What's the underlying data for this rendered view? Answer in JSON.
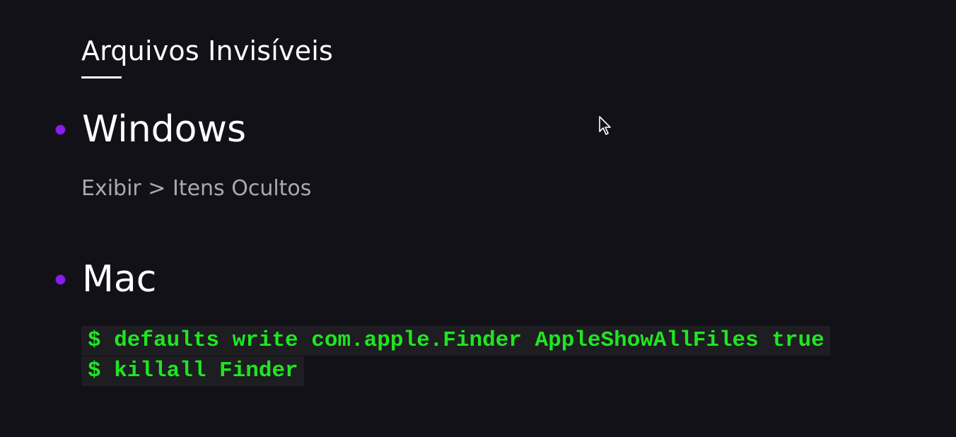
{
  "slide": {
    "title": "Arquivos Invisíveis",
    "sections": [
      {
        "heading": "Windows",
        "description": "Exibir > Itens Ocultos"
      },
      {
        "heading": "Mac",
        "code_lines": [
          "$ defaults write com.apple.Finder AppleShowAllFiles true",
          "$ killall Finder"
        ]
      }
    ]
  },
  "colors": {
    "background": "#121117",
    "bullet": "#8a1cf0",
    "code_text": "#1fe620",
    "code_background": "#1d1d22",
    "muted_text": "#a9a9b2"
  },
  "icons": {
    "pointer": "mouse-pointer-icon",
    "bullet": "bullet-dot-icon"
  }
}
